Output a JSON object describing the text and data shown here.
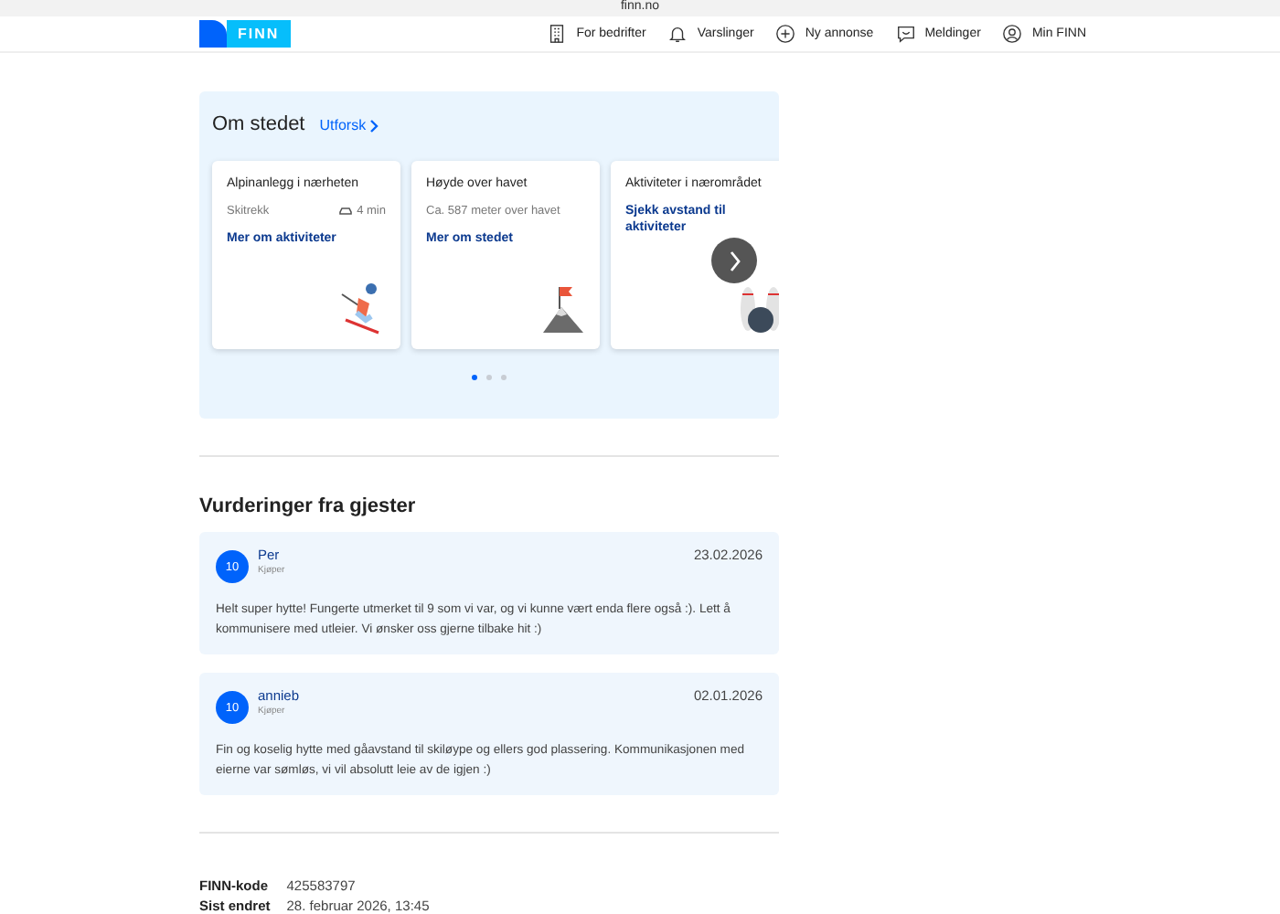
{
  "browser": {
    "url": "finn.no"
  },
  "header": {
    "logo": "FINN",
    "nav": [
      {
        "kind": "building",
        "label": "For bedrifter"
      },
      {
        "kind": "bell",
        "label": "Varslinger"
      },
      {
        "kind": "plus",
        "label": "Ny annonse"
      },
      {
        "kind": "chat",
        "label": "Meldinger"
      },
      {
        "kind": "user",
        "label": "Min FINN"
      }
    ]
  },
  "place": {
    "title": "Om stedet",
    "link": "Utforsk",
    "cards": [
      {
        "kind": "ski",
        "title": "Alpinanlegg i nærheten",
        "detail": "Skitrekk",
        "time": "4 min",
        "link": "Mer om aktiviteter"
      },
      {
        "kind": "mountain",
        "title": "Høyde over havet",
        "detail": "Ca. 587 meter over havet",
        "link": "Mer om stedet"
      },
      {
        "kind": "bowling",
        "title": "Aktiviteter i nærområdet",
        "link": "Sjekk avstand til aktiviteter"
      }
    ],
    "dots": [
      {
        "selected": true
      },
      {
        "selected": false
      },
      {
        "selected": false
      }
    ]
  },
  "reviews": {
    "title": "Vurderinger fra gjester",
    "items": [
      {
        "score": "10",
        "name": "Per",
        "role": "Kjøper",
        "date": "23.02.2026",
        "text": "Helt super hytte! Fungerte utmerket til 9 som vi var, og vi kunne vært enda flere også :). Lett å kommunisere med utleier. Vi ønsker oss gjerne tilbake hit :)"
      },
      {
        "score": "10",
        "name": "annieb",
        "role": "Kjøper",
        "date": "02.01.2026",
        "text": "Fin og koselig hytte med gåavstand til skiløype og ellers god plassering. Kommunikasjonen med eierne var sømløs, vi vil absolutt leie av de igjen :)"
      }
    ]
  },
  "info": [
    {
      "label": "FINN-kode",
      "value": "425583797"
    },
    {
      "label": "Sist endret",
      "value": "28. februar 2026, 13:45"
    }
  ]
}
